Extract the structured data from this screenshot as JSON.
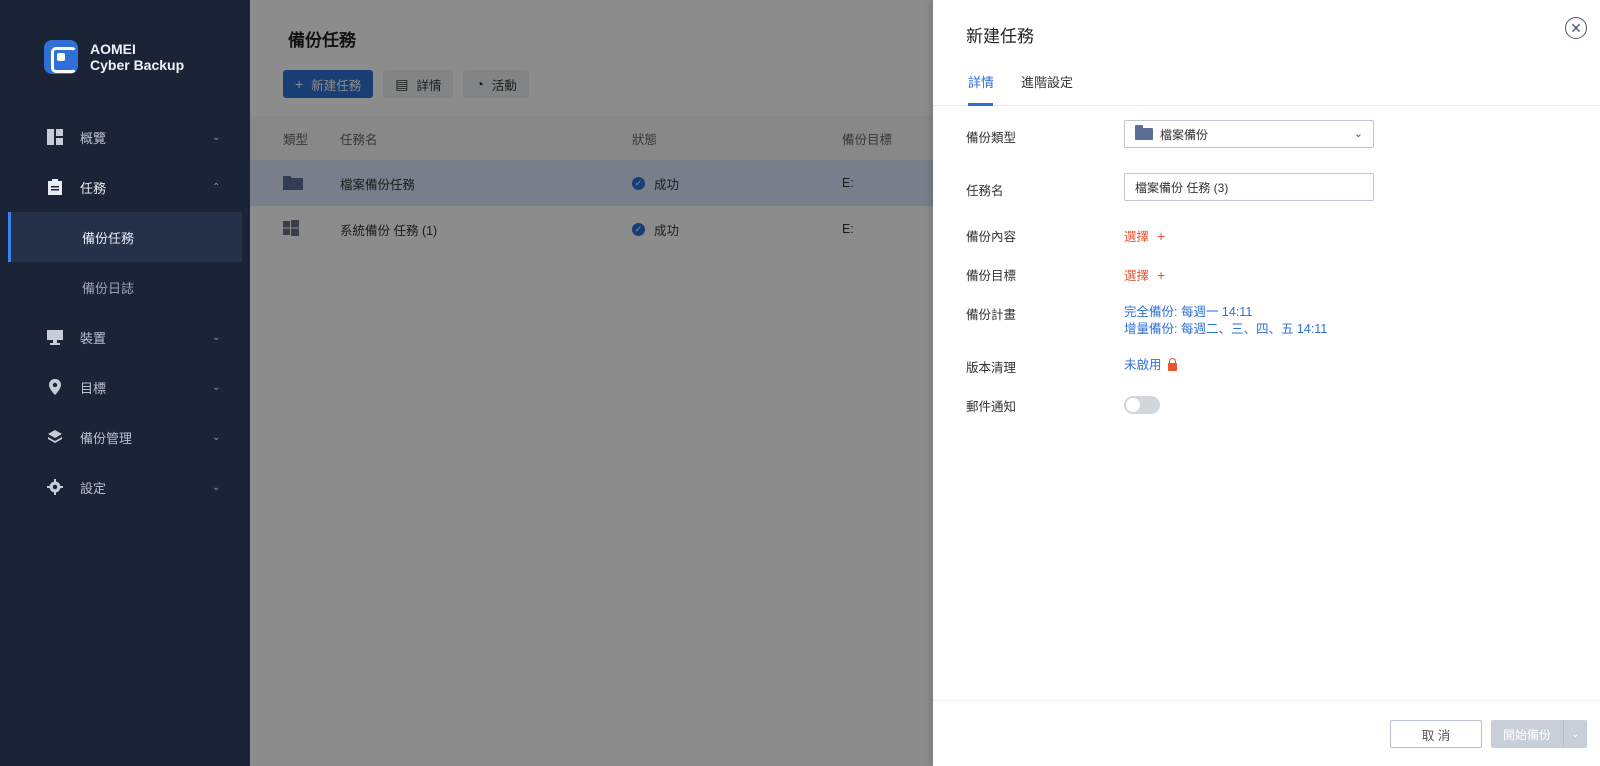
{
  "brand": {
    "line1": "AOMEI",
    "line2": "Cyber Backup"
  },
  "sidebar": {
    "items": [
      {
        "label": "概覽",
        "icon": "dashboard-icon"
      },
      {
        "label": "任務",
        "icon": "clipboard-icon"
      },
      {
        "label": "裝置",
        "icon": "monitor-icon"
      },
      {
        "label": "目標",
        "icon": "location-pin-icon"
      },
      {
        "label": "備份管理",
        "icon": "layers-icon"
      },
      {
        "label": "設定",
        "icon": "gear-icon"
      }
    ],
    "sub_items": [
      {
        "label": "備份任務",
        "active": true
      },
      {
        "label": "備份日誌",
        "active": false
      }
    ]
  },
  "main": {
    "title": "備份任務",
    "toolbar": {
      "new_task": "新建任務",
      "details": "詳情",
      "activity": "活動"
    },
    "table": {
      "headers": [
        "類型",
        "任務名",
        "狀態",
        "備份目標"
      ],
      "rows": [
        {
          "type_icon": "folder-icon",
          "name": "檔案備份任務",
          "status": "成功",
          "target": "E:"
        },
        {
          "type_icon": "windows-icon",
          "name": "系統備份 任務 (1)",
          "status": "成功",
          "target": "E:"
        }
      ]
    }
  },
  "drawer": {
    "title": "新建任務",
    "tabs": [
      "詳情",
      "進階設定"
    ],
    "fields": {
      "backup_type_label": "備份類型",
      "backup_type_value": "檔案備份",
      "task_name_label": "任務名",
      "task_name_value": "檔案備份 任務 (3)",
      "content_label": "備份內容",
      "content_link": "選擇",
      "target_label": "備份目標",
      "target_link": "選擇",
      "schedule_label": "備份計畫",
      "schedule_full": "完全備份: 每週一 14:11",
      "schedule_incr": "增量備份: 每週二、三、四、五 14:11",
      "cleanup_label": "版本清理",
      "cleanup_value": "未啟用",
      "email_label": "郵件通知",
      "email_enabled": false
    },
    "footer": {
      "cancel": "取 消",
      "start": "開始備份"
    }
  },
  "colors": {
    "accent": "#2f6fd6",
    "sidebar_bg": "#1b2436",
    "link_red": "#e8552f"
  }
}
